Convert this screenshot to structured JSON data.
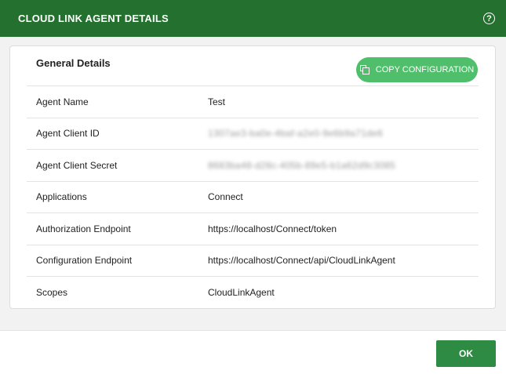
{
  "header": {
    "title": "CLOUD LINK AGENT DETAILS",
    "help_glyph": "?"
  },
  "card": {
    "title": "General Details",
    "copy_label": "COPY CONFIGURATION",
    "rows": [
      {
        "label": "Agent Name",
        "value": "Test"
      },
      {
        "label": "Agent Client ID",
        "value": "1307ae3-ba0e-4baf-a2e0-9e6b9a71de6"
      },
      {
        "label": "Agent Client Secret",
        "value": "8683ba48-d28c-405b-89e5-b1a62d9c3085"
      },
      {
        "label": "Applications",
        "value": "Connect"
      },
      {
        "label": "Authorization Endpoint",
        "value": "https://localhost/Connect/token"
      },
      {
        "label": "Configuration Endpoint",
        "value": "https://localhost/Connect/api/CloudLinkAgent"
      },
      {
        "label": "Scopes",
        "value": "CloudLinkAgent"
      }
    ]
  },
  "footer": {
    "ok_label": "OK"
  },
  "colors": {
    "header": "#23702f",
    "copy_button": "#4fbf6b",
    "ok_button": "#2e8b44"
  }
}
